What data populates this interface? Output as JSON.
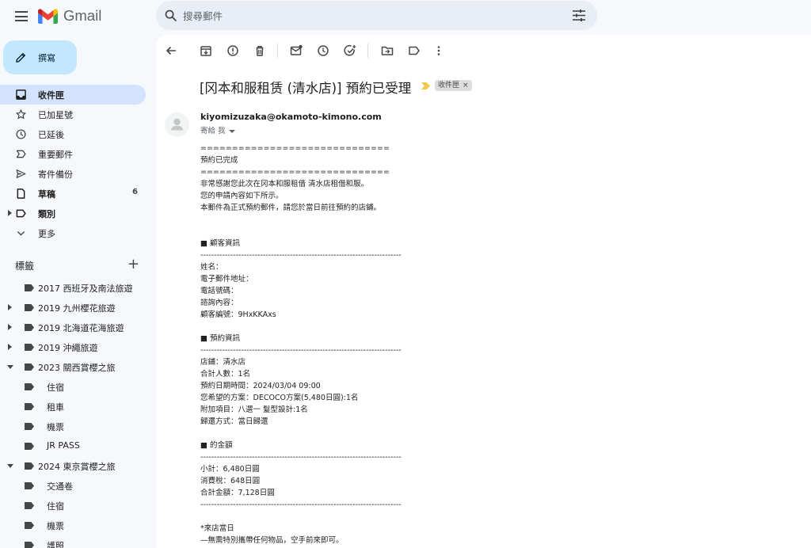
{
  "app": {
    "name": "Gmail"
  },
  "search": {
    "placeholder": "搜尋郵件"
  },
  "compose": {
    "label": "撰寫"
  },
  "nav": [
    {
      "label": "收件匣",
      "icon": "inbox-icon",
      "active": true,
      "bold": true,
      "count": ""
    },
    {
      "label": "已加星號",
      "icon": "star-icon",
      "count": ""
    },
    {
      "label": "已延後",
      "icon": "clock-icon",
      "count": ""
    },
    {
      "label": "重要郵件",
      "icon": "important-icon",
      "count": ""
    },
    {
      "label": "寄件備份",
      "icon": "send-icon",
      "count": ""
    },
    {
      "label": "草稿",
      "icon": "draft-icon",
      "bold": true,
      "count": "6"
    },
    {
      "label": "類別",
      "icon": "category-icon",
      "bold": true,
      "count": "",
      "caret": true
    },
    {
      "label": "更多",
      "icon": "chevron-down-icon",
      "count": ""
    }
  ],
  "labels_header": {
    "title": "標籤",
    "add": "+"
  },
  "labels": [
    {
      "label": "2017 西班牙及南法旅遊",
      "level": 0,
      "caret": ""
    },
    {
      "label": "2019 九州櫻花旅遊",
      "level": 0,
      "caret": "right"
    },
    {
      "label": "2019 北海道花海旅遊",
      "level": 0,
      "caret": "right"
    },
    {
      "label": "2019 沖繩旅遊",
      "level": 0,
      "caret": "right"
    },
    {
      "label": "2023 關西賞櫻之旅",
      "level": 0,
      "caret": "down"
    },
    {
      "label": "住宿",
      "level": 1,
      "caret": ""
    },
    {
      "label": "租車",
      "level": 1,
      "caret": ""
    },
    {
      "label": "機票",
      "level": 1,
      "caret": ""
    },
    {
      "label": "JR PASS",
      "level": 1,
      "caret": ""
    },
    {
      "label": "2024 東京賞櫻之旅",
      "level": 0,
      "caret": "down"
    },
    {
      "label": "交通卷",
      "level": 1,
      "caret": ""
    },
    {
      "label": "住宿",
      "level": 1,
      "caret": ""
    },
    {
      "label": "機票",
      "level": 1,
      "caret": ""
    },
    {
      "label": "護照",
      "level": 1,
      "caret": ""
    }
  ],
  "email": {
    "subject": "[冈本和服租赁 (清水店)] 預約已受理",
    "chip": "收件匣",
    "chip_close": "×",
    "sender": "kiyomizuzaka@okamoto-kimono.com",
    "to": "寄給 我",
    "body": [
      "==============================",
      "預約已完成",
      "==============================",
      "非常感謝您此次在冈本和服租借 清水店租借和服。",
      "您的申請內容如下所示。",
      "本郵件為正式預約郵件，請您於當日前往預約的店鋪。",
      "",
      "",
      "■ 顧客資訊",
      "--------------------------------------------------------------------------",
      "姓名：",
      "電子郵件地址：",
      "電話號碼：",
      "諮詢內容：",
      "顧客編號：9HxKKAxs",
      "",
      "■ 預約資訊",
      "--------------------------------------------------------------------------",
      "店鋪：清水店",
      "合計人數：1名",
      "預約日期時間：2024/03/04 09:00",
      "您希望的方案：DECOCO方案(5,480日圓):1名",
      "附加項目：八選一 髮型設計:1名",
      "歸還方式：當日歸還",
      "",
      "■ 的金額",
      "--------------------------------------------------------------------------",
      "小計：6,480日圓",
      "消費稅：648日圓",
      "合計金額：7,128日圓",
      "--------------------------------------------------------------------------",
      "",
      "*來店當日",
      "—無需特別攜帶任何物品，空手前來即可。"
    ]
  },
  "colors": {
    "active_nav": "#d3e3fd",
    "compose_bg": "#c2e7ff",
    "search_bg": "#e9eef6",
    "page_bg": "#f6f8fc",
    "importance_marker": "#f2c94c"
  }
}
